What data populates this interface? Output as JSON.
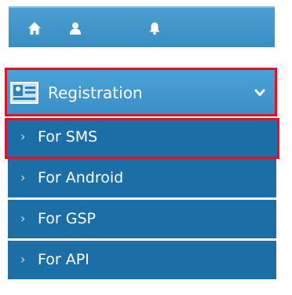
{
  "topbar": {
    "icons": [
      "home-icon",
      "user-icon",
      "bell-icon"
    ]
  },
  "registration": {
    "label": "Registration",
    "icon": "id-card-icon",
    "toggle_icon": "chevron-down-icon"
  },
  "menu": {
    "items": [
      {
        "label": "For SMS",
        "arrow": "›",
        "selected": true
      },
      {
        "label": "For Android",
        "arrow": "›",
        "selected": false
      },
      {
        "label": "For GSP",
        "arrow": "›",
        "selected": false
      },
      {
        "label": "For API",
        "arrow": "›",
        "selected": false
      }
    ]
  },
  "colors": {
    "accent": "#3b90c7",
    "item_bg": "#1c6ea6",
    "highlight": "#e0141e"
  }
}
